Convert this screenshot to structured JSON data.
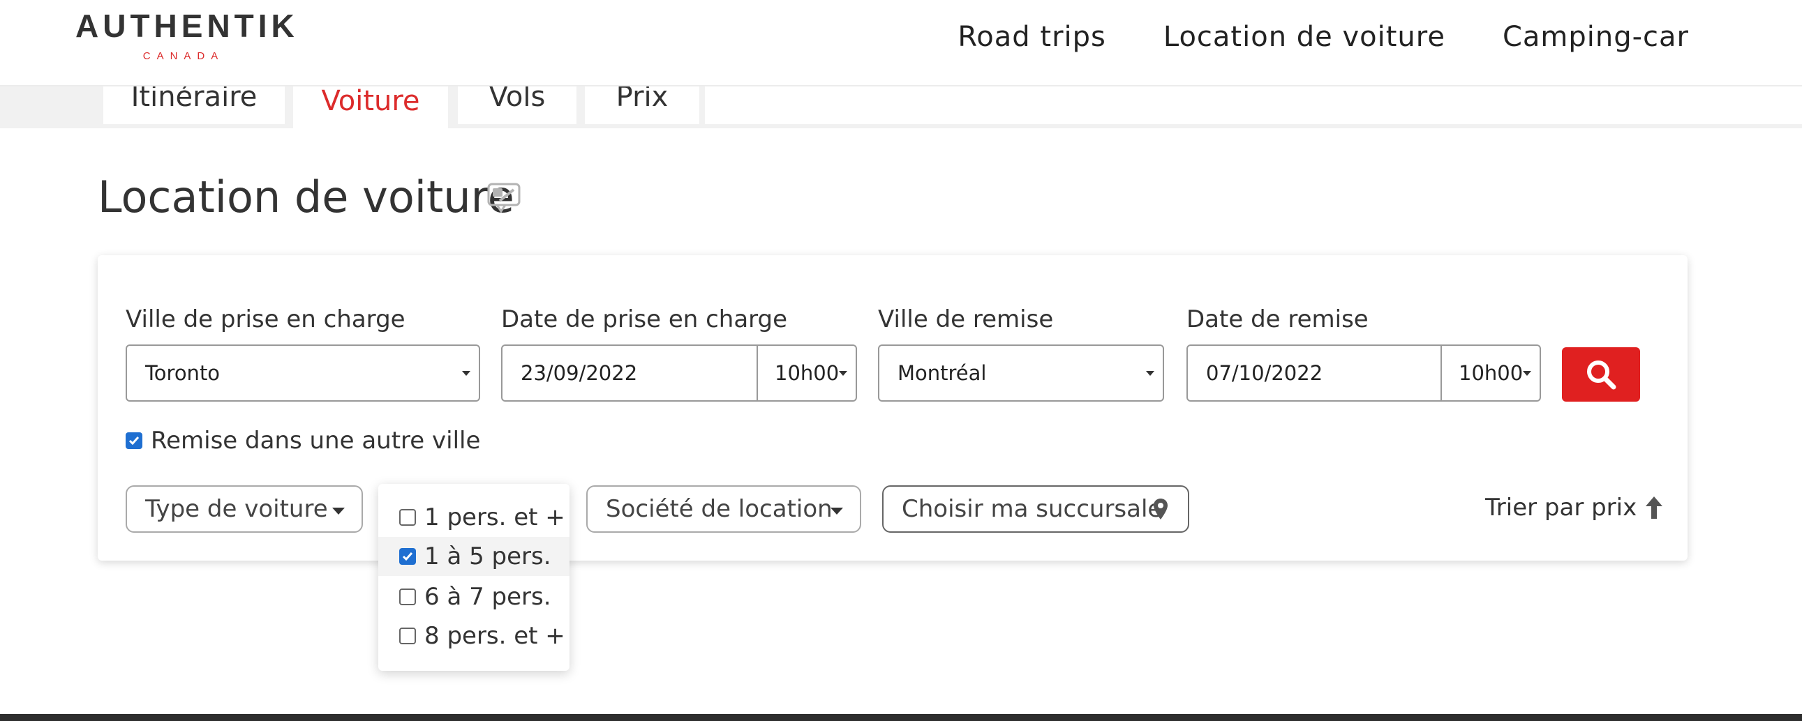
{
  "header": {
    "logo_main": "AUTHENTIK",
    "logo_sub": "CANADA",
    "nav": [
      "Road trips",
      "Location de voiture",
      "Camping-car"
    ]
  },
  "tabs": [
    "Itinéraire",
    "Voiture",
    "Vols",
    "Prix"
  ],
  "active_tab": "Voiture",
  "page_title": "Location de voiture",
  "form": {
    "pickup_city_label": "Ville de prise en charge",
    "pickup_city_value": "Toronto",
    "pickup_date_label": "Date de prise en charge",
    "pickup_date_value": "23/09/2022",
    "pickup_time_value": "10h00",
    "dropoff_city_label": "Ville de remise",
    "dropoff_city_value": "Montréal",
    "dropoff_date_label": "Date de remise",
    "dropoff_date_value": "07/10/2022",
    "dropoff_time_value": "10h00",
    "other_city_label": "Remise dans une autre ville",
    "other_city_checked": true
  },
  "filters": {
    "car_type_label": "Type de voiture",
    "company_label": "Société de location",
    "branch_label": "Choisir ma succursale",
    "sort_label": "Trier par prix"
  },
  "dropdown_options": [
    {
      "label": "1 pers. et +",
      "checked": false
    },
    {
      "label": "1 à 5 pers.",
      "checked": true
    },
    {
      "label": "6 à 7 pers.",
      "checked": false
    },
    {
      "label": "8 pers. et +",
      "checked": false
    }
  ],
  "colors": {
    "accent_red": "#e02020",
    "checkbox_blue": "#1f6fd1",
    "footer_dark": "#2e2e2e"
  },
  "icons": {
    "title": "chat-edit-icon",
    "search": "search-icon",
    "branch": "map-pin-icon",
    "sort": "arrow-up-icon"
  }
}
